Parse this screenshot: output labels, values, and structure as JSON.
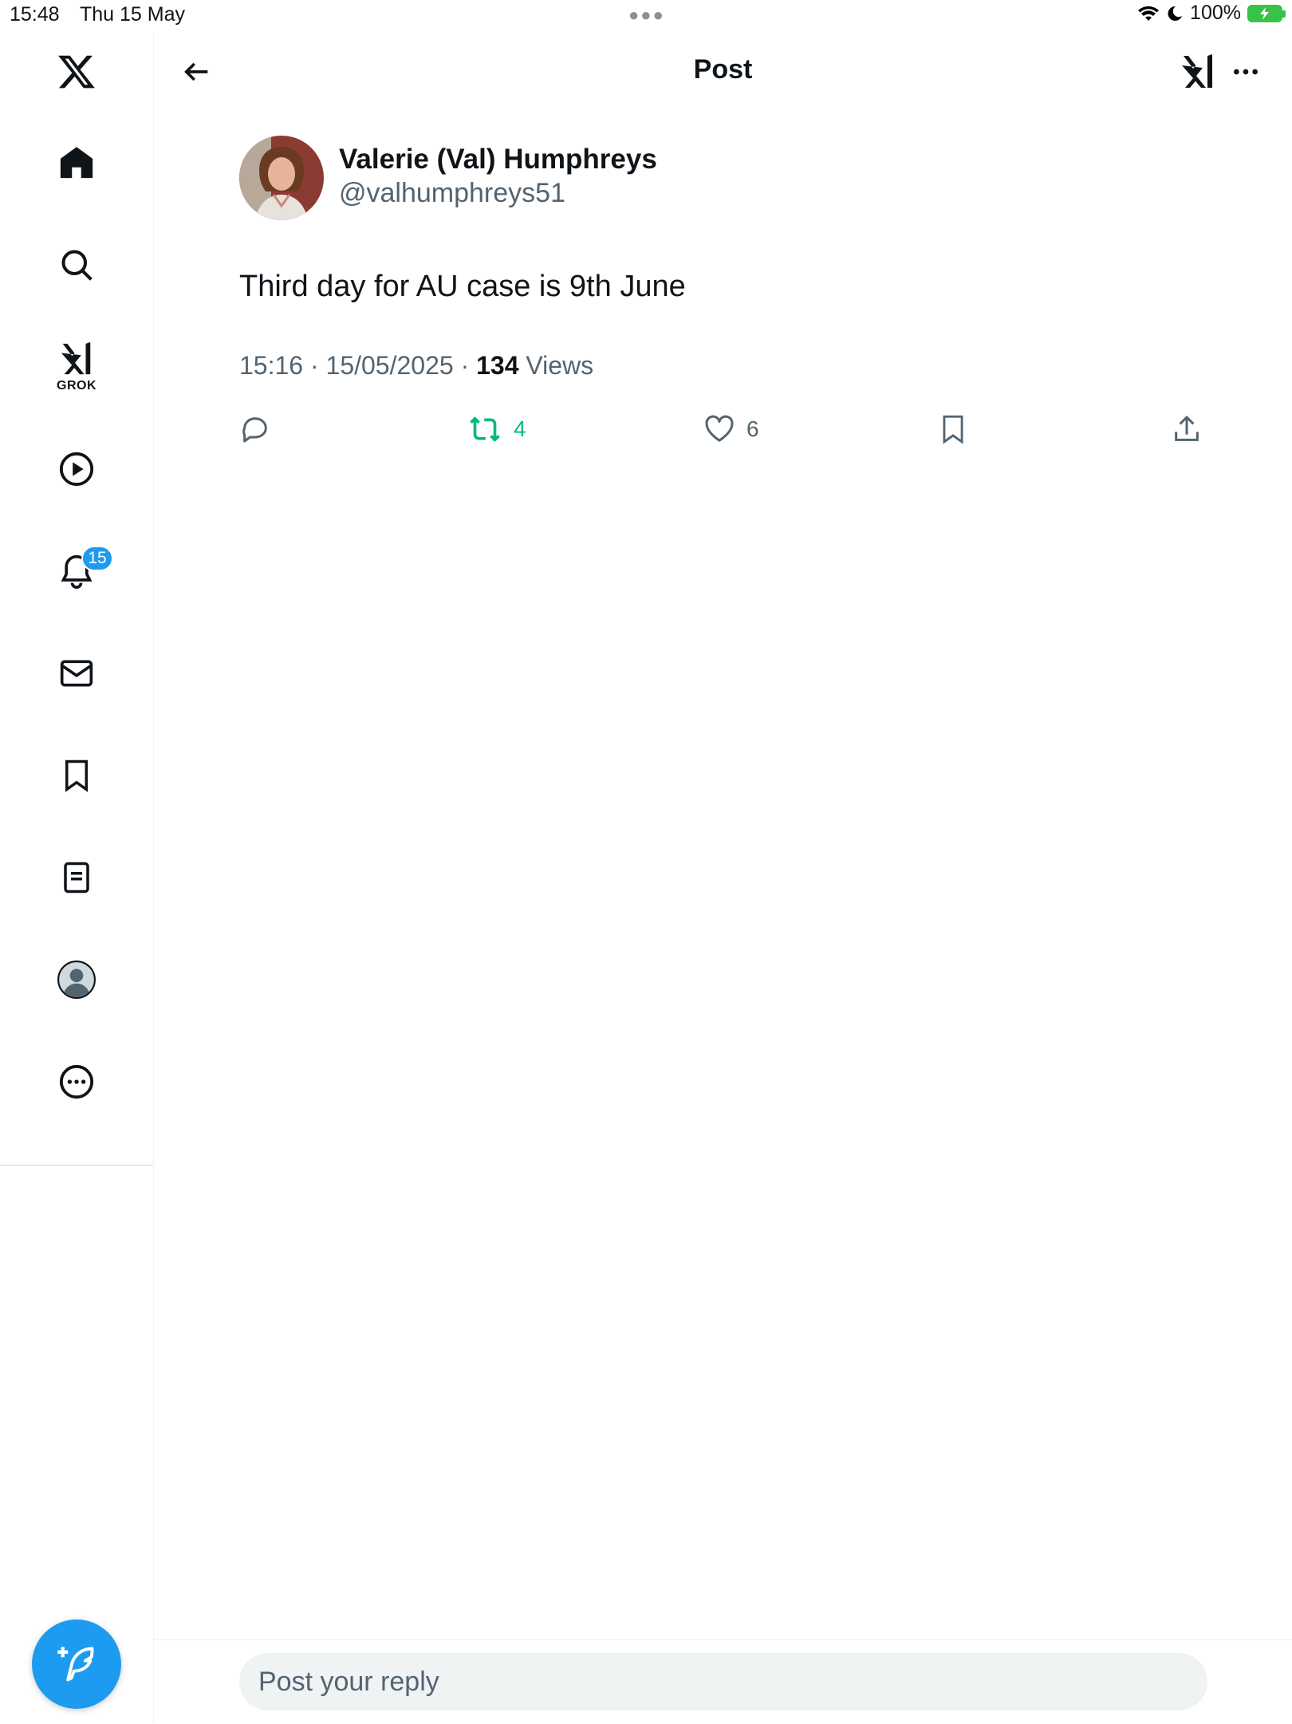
{
  "status_bar": {
    "time": "15:48",
    "date": "Thu 15 May",
    "battery": "100%",
    "colors": {
      "battery": "#39c14a"
    }
  },
  "sidebar": {
    "items": [
      {
        "name": "logo",
        "icon": "x-logo-icon"
      },
      {
        "name": "home",
        "icon": "home-icon"
      },
      {
        "name": "search",
        "icon": "search-icon"
      },
      {
        "name": "grok",
        "icon": "grok-icon",
        "label": "GROK"
      },
      {
        "name": "video",
        "icon": "play-icon"
      },
      {
        "name": "notifications",
        "icon": "bell-icon",
        "badge": "15"
      },
      {
        "name": "messages",
        "icon": "mail-icon"
      },
      {
        "name": "bookmarks",
        "icon": "bookmark-icon"
      },
      {
        "name": "lists",
        "icon": "list-icon"
      },
      {
        "name": "profile",
        "icon": "avatar-icon"
      },
      {
        "name": "more",
        "icon": "more-circle-icon"
      }
    ],
    "compose_icon": "compose-icon"
  },
  "header": {
    "title": "Post"
  },
  "post": {
    "author_name": "Valerie (Val) Humphreys",
    "author_handle": "@valhumphreys51",
    "text": "Third day for AU case is 9th June",
    "timestamp": "15:16 · 15/05/2025 · ",
    "views_count": "134",
    "views_label": " Views",
    "actions": {
      "replies": "",
      "reposts": "4",
      "likes": "6"
    }
  },
  "reply": {
    "placeholder": "Post your reply"
  },
  "colors": {
    "accent": "#1d9bf0",
    "repost_active": "#00ba7c",
    "secondary_text": "#536471"
  }
}
